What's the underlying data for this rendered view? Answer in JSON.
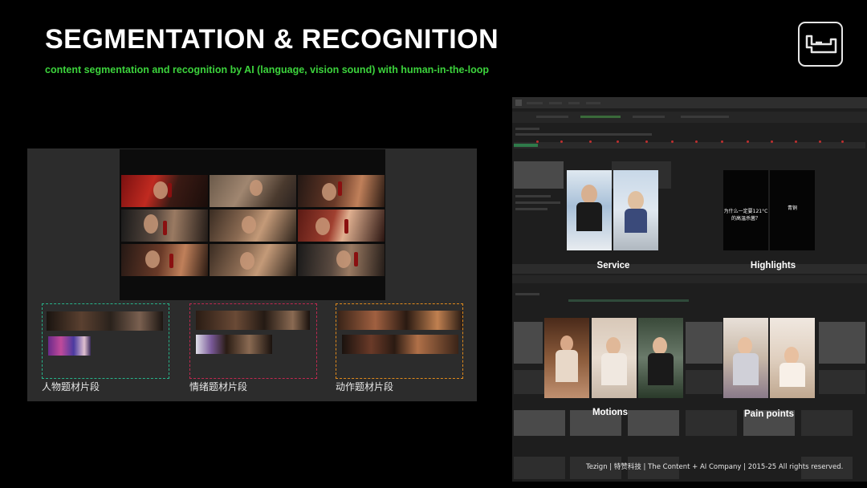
{
  "header": {
    "title": "SEGMENTATION & RECOGNITION",
    "subtitle": "content segmentation and recognition by AI (language, vision sound) with human-in-the-loop"
  },
  "logo": {
    "icon": "tezign-logo-icon"
  },
  "segments": [
    {
      "label": "人物题材片段",
      "color": "#27b38a"
    },
    {
      "label": "情绪题材片段",
      "color": "#c02850"
    },
    {
      "label": "动作题材片段",
      "color": "#e08a1c"
    }
  ],
  "recognition": {
    "service_label": "Service",
    "highlights_label": "Highlights",
    "highlight_caption_1": "为什么一定要121°C的高温杀菌？",
    "highlight_caption_2": "青铜",
    "motions_label": "Motions",
    "pain_points_label": "Pain points"
  },
  "footer": {
    "text": "Tezign | 特赞科技 | The Content + AI Company | 2015-25 All rights reserved."
  },
  "colors": {
    "accent_green": "#3cd33c",
    "background": "#000000",
    "panel": "#2c2c2c"
  }
}
